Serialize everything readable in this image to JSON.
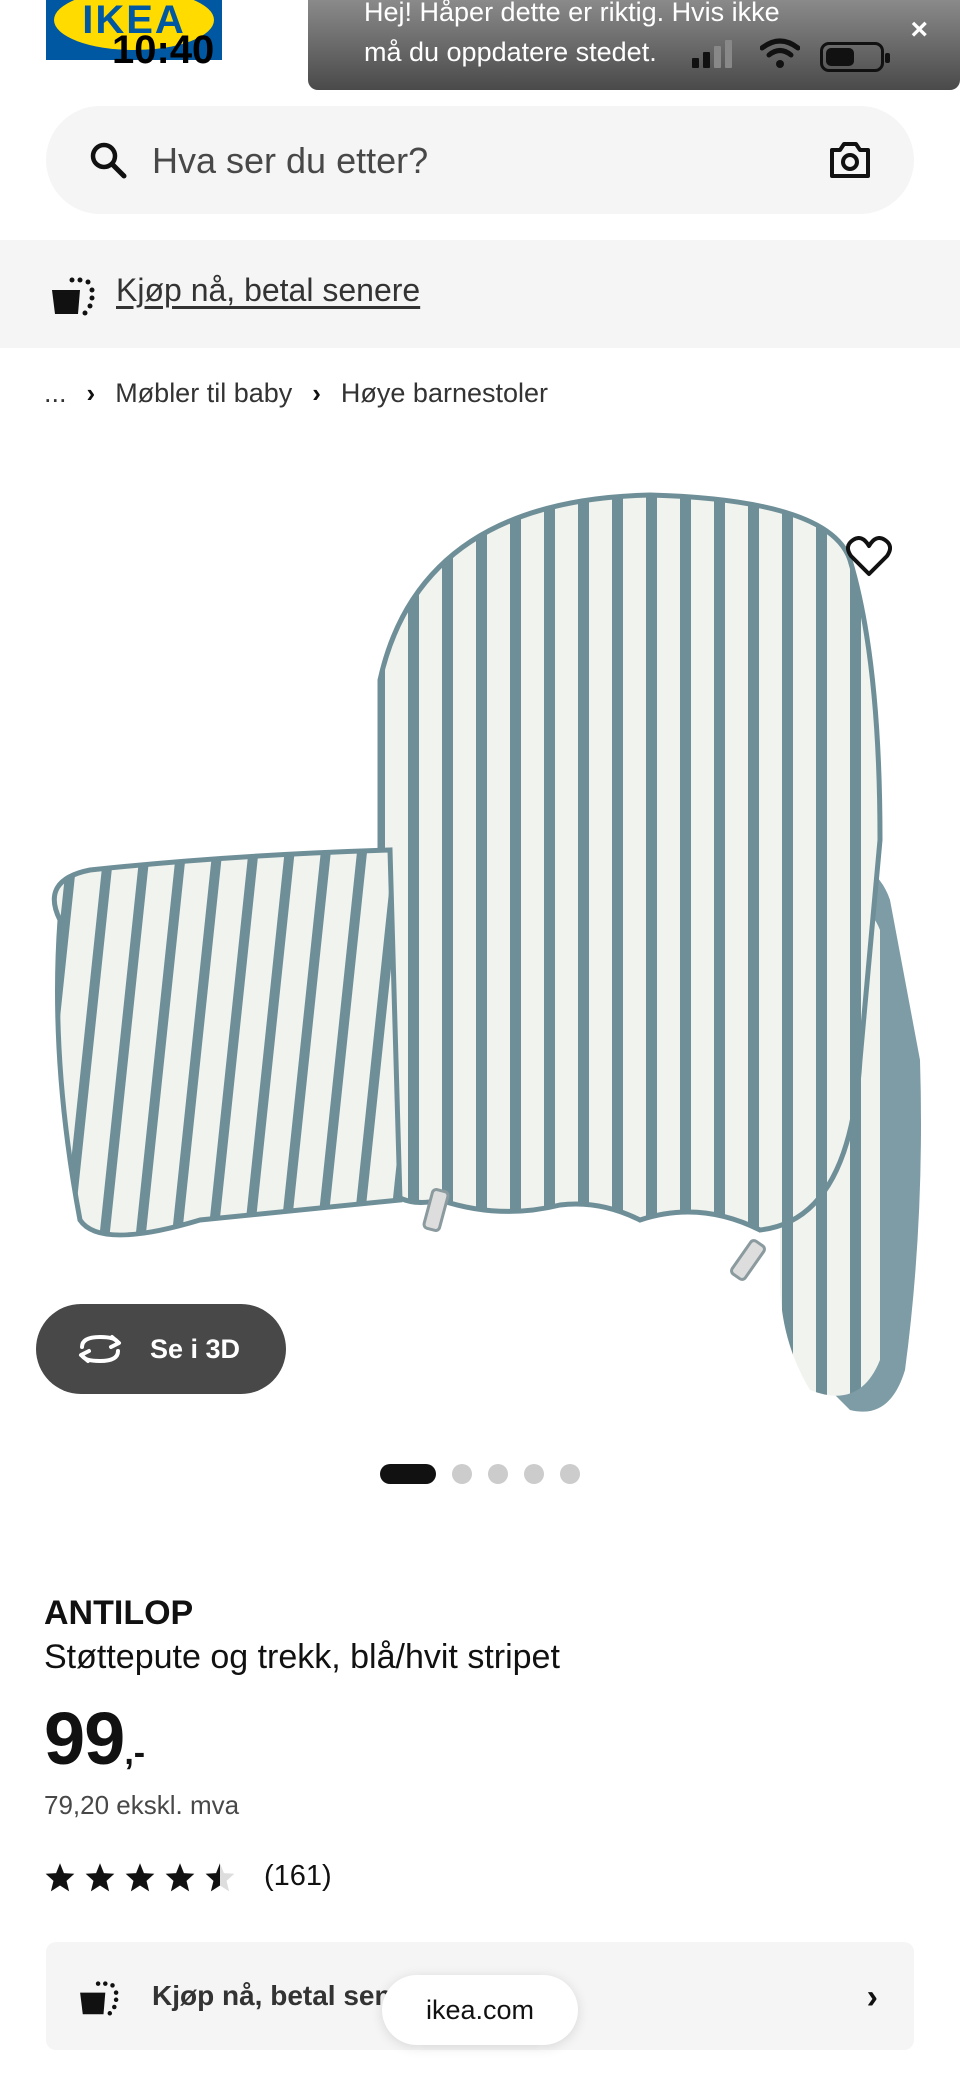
{
  "status_bar": {
    "time": "10:40",
    "logo_text": "IKEA"
  },
  "toast": {
    "line1": "Hej! Håper dette er riktig. Hvis ikke",
    "line2": "må du oppdatere stedet.",
    "close_label": "×"
  },
  "search": {
    "placeholder": "Hva ser du etter?",
    "icon": "search-icon",
    "camera_icon": "camera-icon"
  },
  "banner": {
    "text": "Kjøp nå, betal senere"
  },
  "breadcrumb": {
    "ellipsis": "...",
    "items": [
      "Møbler til baby",
      "Høye barnestoler"
    ]
  },
  "product": {
    "see_3d_label": "Se i 3D",
    "image_count": 5,
    "active_image": 0,
    "brand": "ANTILOP",
    "description": "Støttepute og trekk, blå/hvit stripet",
    "price_main": "99",
    "price_suffix": ",-",
    "price_excl": "79,20 ekskl. mva",
    "rating": 4.5,
    "rating_max": 5,
    "rating_count": "(161)"
  },
  "klarna": {
    "text": "Kjøp nå, betal senere"
  },
  "url_pill": "ikea.com",
  "colors": {
    "accent": "#0058a3",
    "logo_yellow": "#ffdb00",
    "stripe_blue": "#6f8f98",
    "cushion_white": "#f1f3ee"
  }
}
